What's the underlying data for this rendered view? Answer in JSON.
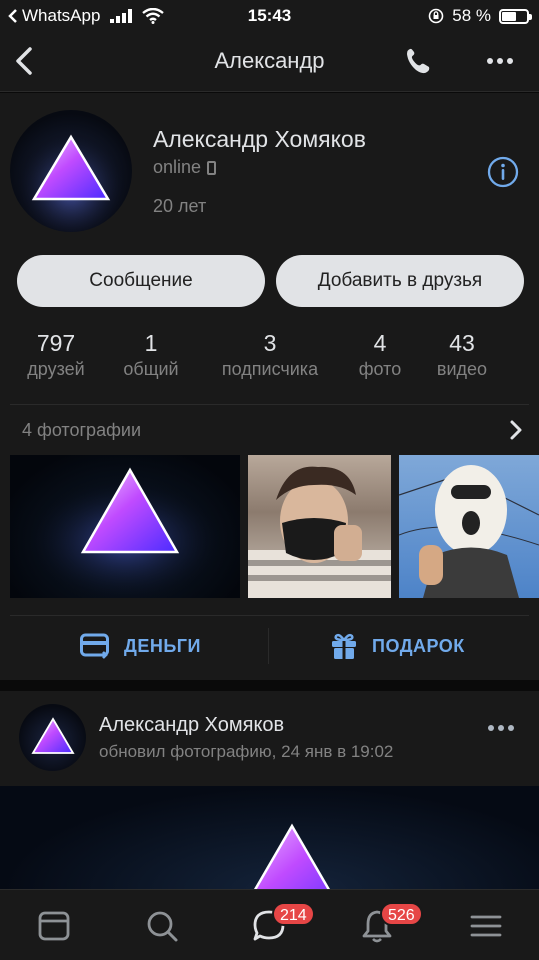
{
  "status_bar": {
    "back_app": "WhatsApp",
    "time": "15:43",
    "battery": "58 %",
    "battery_level": 0.58
  },
  "header": {
    "title": "Александр"
  },
  "profile": {
    "name": "Александр Хомяков",
    "status": "online",
    "age": "20 лет",
    "message_button": "Сообщение",
    "add_friend_button": "Добавить в друзья",
    "counters": [
      {
        "num": "797",
        "label": "друзей"
      },
      {
        "num": "1",
        "label": "общий"
      },
      {
        "num": "3",
        "label": "подписчика"
      },
      {
        "num": "4",
        "label": "фото"
      },
      {
        "num": "43",
        "label": "видео"
      }
    ],
    "photos_title": "4 фотографии",
    "money_label": "ДЕНЬГИ",
    "gift_label": "ПОДАРОК"
  },
  "post": {
    "author": "Александр Хомяков",
    "subtitle": "обновил фотографию, 24 янв в 19:02"
  },
  "tabbar": {
    "messages_badge": "214",
    "notifications_badge": "526"
  },
  "colors": {
    "accent": "#71aaeb",
    "background": "#191919",
    "badge": "#e64646"
  }
}
